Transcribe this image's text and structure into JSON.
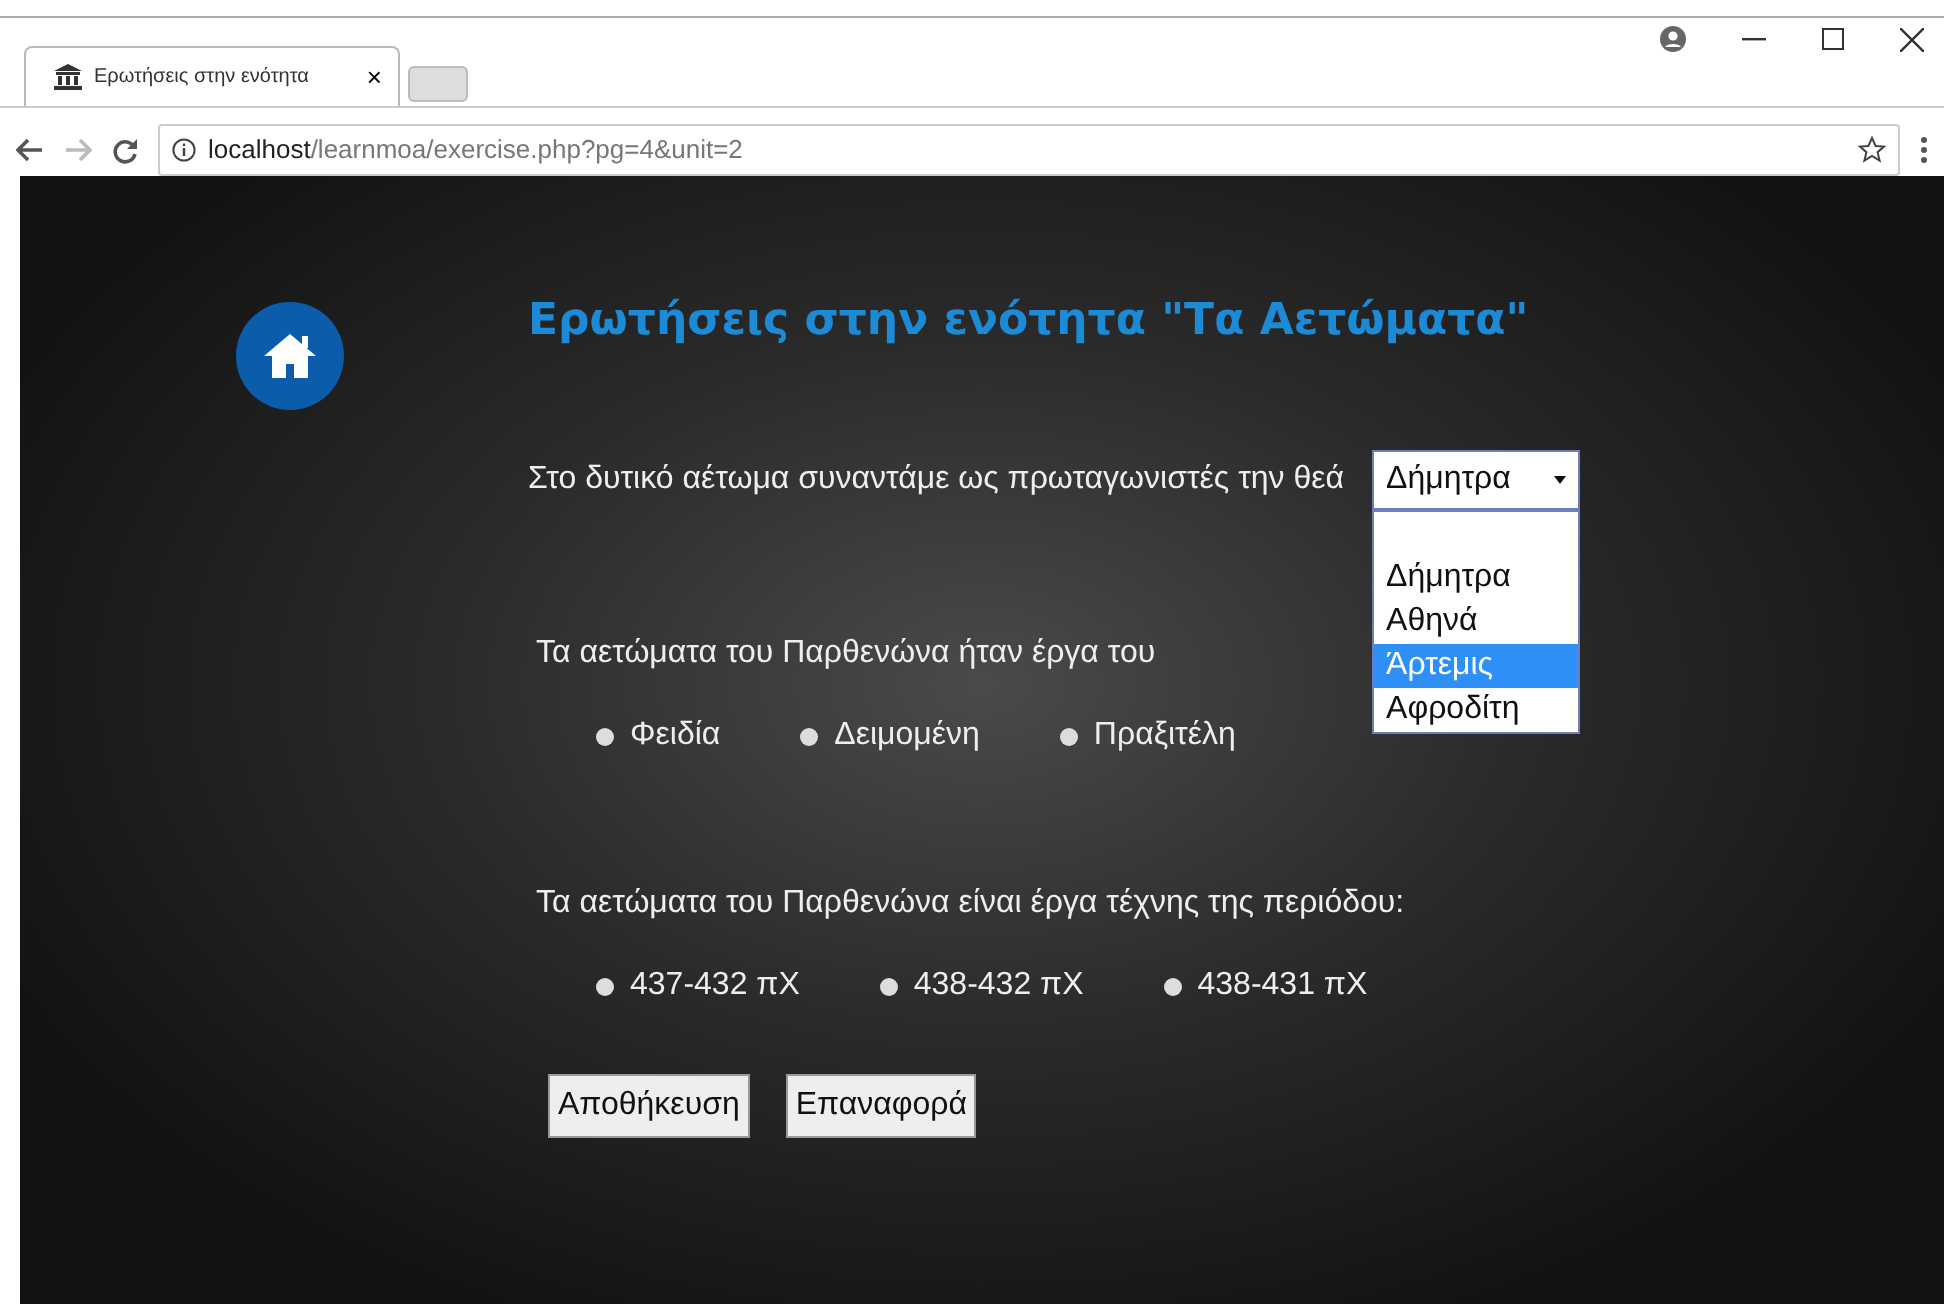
{
  "browser": {
    "tab_title": "Ερωτήσεις στην ενότητα",
    "tab_close": "×",
    "url_host": "localhost",
    "url_path": "/learnmoa/exercise.php?pg=4&unit=2"
  },
  "page": {
    "title": "Ερωτήσεις στην ενότητα \"Τα Αετώματα\"",
    "questions": [
      {
        "kind": "select",
        "text": "Στο δυτικό αέτωμα συναντάμε ως πρωταγωνιστές την θεά",
        "value": "Δήμητρα",
        "expanded": true,
        "options": [
          {
            "label": "Δήμητρα",
            "highlighted": false
          },
          {
            "label": "Αθηνά",
            "highlighted": false
          },
          {
            "label": "Άρτεμις",
            "highlighted": true
          },
          {
            "label": "Αφροδίτη",
            "highlighted": false
          }
        ]
      },
      {
        "kind": "radio",
        "text": "Τα αετώματα του Παρθενώνα ήταν έργα του",
        "options": [
          {
            "label": "Φειδία",
            "selected": false
          },
          {
            "label": "Δειμομένη",
            "selected": false
          },
          {
            "label": "Πραξιτέλη",
            "selected": false
          }
        ]
      },
      {
        "kind": "radio",
        "text": "Τα αετώματα του Παρθενώνα είναι έργα τέχνης της περιόδου:",
        "options": [
          {
            "label": "437-432 πΧ",
            "selected": false
          },
          {
            "label": "438-432 πΧ",
            "selected": false
          },
          {
            "label": "438-431 πΧ",
            "selected": false
          }
        ]
      }
    ],
    "buttons": [
      "Αποθήκευση",
      "Επαναφορά"
    ]
  }
}
